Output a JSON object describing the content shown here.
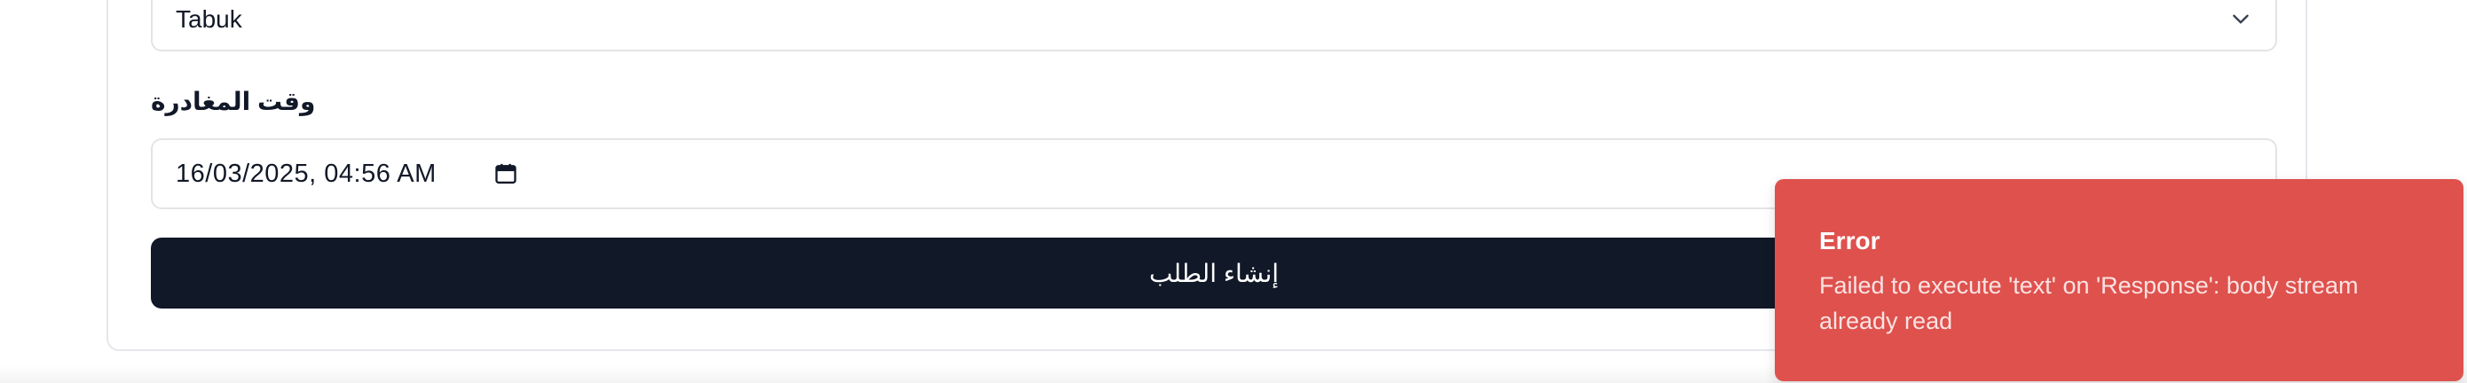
{
  "form": {
    "city_select": {
      "value": "Tabuk"
    },
    "departure_label": "وقت المغادرة",
    "departure_value": "16/03/2025, 04:56  AM",
    "submit_label": "إنشاء الطلب"
  },
  "toast": {
    "title": "Error",
    "message": "Failed to execute 'text' on 'Response': body stream already read",
    "color": "#de514d"
  },
  "icons": {
    "select": "chevron-down-icon",
    "datetime": "calendar-icon"
  },
  "colors": {
    "button_bg": "#111827",
    "border": "#e4e4e7"
  }
}
